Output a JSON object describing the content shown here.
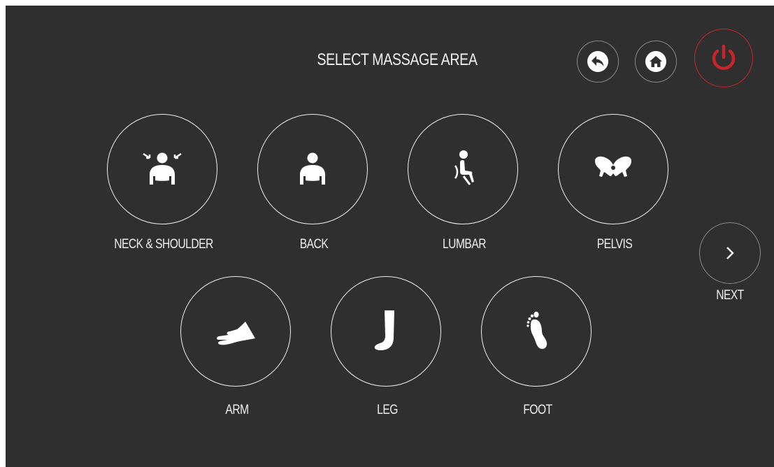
{
  "header": {
    "title": "SELECT MASSAGE AREA",
    "back_icon": "back-arrow-icon",
    "home_icon": "home-icon",
    "power_icon": "power-icon",
    "power_color": "#c8252a"
  },
  "areas": {
    "neck_shoulder": "NECK & SHOULDER",
    "back": "BACK",
    "lumbar": "LUMBAR",
    "pelvis": "PELVIS",
    "arm": "ARM",
    "leg": "LEG",
    "foot": "FOOT"
  },
  "next": {
    "label": "NEXT",
    "icon": "chevron-right-icon"
  },
  "colors": {
    "background": "#2f2f30",
    "foreground": "#f0f0f0",
    "accent": "#c8252a"
  }
}
